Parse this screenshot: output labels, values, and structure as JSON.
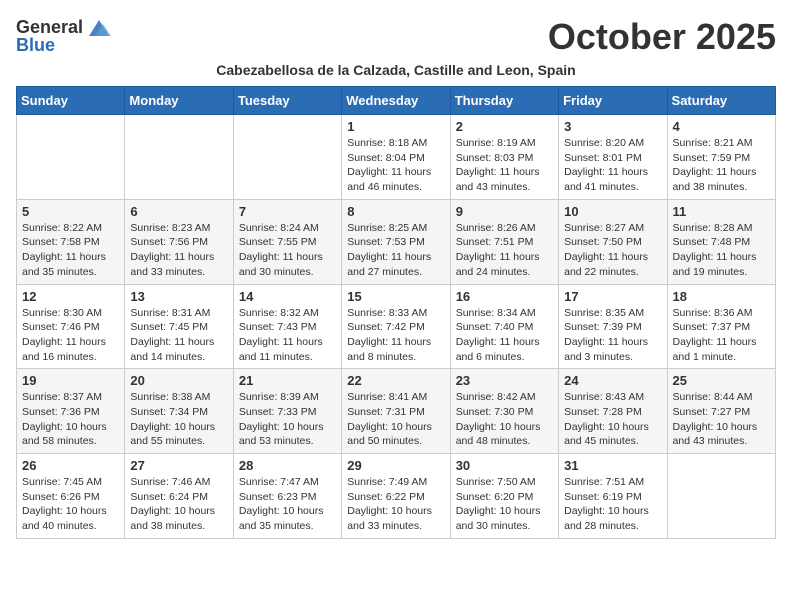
{
  "header": {
    "logo_general": "General",
    "logo_blue": "Blue",
    "month_title": "October 2025",
    "subtitle": "Cabezabellosa de la Calzada, Castille and Leon, Spain"
  },
  "weekdays": [
    "Sunday",
    "Monday",
    "Tuesday",
    "Wednesday",
    "Thursday",
    "Friday",
    "Saturday"
  ],
  "weeks": [
    [
      {
        "day": "",
        "info": ""
      },
      {
        "day": "",
        "info": ""
      },
      {
        "day": "",
        "info": ""
      },
      {
        "day": "1",
        "info": "Sunrise: 8:18 AM\nSunset: 8:04 PM\nDaylight: 11 hours and 46 minutes."
      },
      {
        "day": "2",
        "info": "Sunrise: 8:19 AM\nSunset: 8:03 PM\nDaylight: 11 hours and 43 minutes."
      },
      {
        "day": "3",
        "info": "Sunrise: 8:20 AM\nSunset: 8:01 PM\nDaylight: 11 hours and 41 minutes."
      },
      {
        "day": "4",
        "info": "Sunrise: 8:21 AM\nSunset: 7:59 PM\nDaylight: 11 hours and 38 minutes."
      }
    ],
    [
      {
        "day": "5",
        "info": "Sunrise: 8:22 AM\nSunset: 7:58 PM\nDaylight: 11 hours and 35 minutes."
      },
      {
        "day": "6",
        "info": "Sunrise: 8:23 AM\nSunset: 7:56 PM\nDaylight: 11 hours and 33 minutes."
      },
      {
        "day": "7",
        "info": "Sunrise: 8:24 AM\nSunset: 7:55 PM\nDaylight: 11 hours and 30 minutes."
      },
      {
        "day": "8",
        "info": "Sunrise: 8:25 AM\nSunset: 7:53 PM\nDaylight: 11 hours and 27 minutes."
      },
      {
        "day": "9",
        "info": "Sunrise: 8:26 AM\nSunset: 7:51 PM\nDaylight: 11 hours and 24 minutes."
      },
      {
        "day": "10",
        "info": "Sunrise: 8:27 AM\nSunset: 7:50 PM\nDaylight: 11 hours and 22 minutes."
      },
      {
        "day": "11",
        "info": "Sunrise: 8:28 AM\nSunset: 7:48 PM\nDaylight: 11 hours and 19 minutes."
      }
    ],
    [
      {
        "day": "12",
        "info": "Sunrise: 8:30 AM\nSunset: 7:46 PM\nDaylight: 11 hours and 16 minutes."
      },
      {
        "day": "13",
        "info": "Sunrise: 8:31 AM\nSunset: 7:45 PM\nDaylight: 11 hours and 14 minutes."
      },
      {
        "day": "14",
        "info": "Sunrise: 8:32 AM\nSunset: 7:43 PM\nDaylight: 11 hours and 11 minutes."
      },
      {
        "day": "15",
        "info": "Sunrise: 8:33 AM\nSunset: 7:42 PM\nDaylight: 11 hours and 8 minutes."
      },
      {
        "day": "16",
        "info": "Sunrise: 8:34 AM\nSunset: 7:40 PM\nDaylight: 11 hours and 6 minutes."
      },
      {
        "day": "17",
        "info": "Sunrise: 8:35 AM\nSunset: 7:39 PM\nDaylight: 11 hours and 3 minutes."
      },
      {
        "day": "18",
        "info": "Sunrise: 8:36 AM\nSunset: 7:37 PM\nDaylight: 11 hours and 1 minute."
      }
    ],
    [
      {
        "day": "19",
        "info": "Sunrise: 8:37 AM\nSunset: 7:36 PM\nDaylight: 10 hours and 58 minutes."
      },
      {
        "day": "20",
        "info": "Sunrise: 8:38 AM\nSunset: 7:34 PM\nDaylight: 10 hours and 55 minutes."
      },
      {
        "day": "21",
        "info": "Sunrise: 8:39 AM\nSunset: 7:33 PM\nDaylight: 10 hours and 53 minutes."
      },
      {
        "day": "22",
        "info": "Sunrise: 8:41 AM\nSunset: 7:31 PM\nDaylight: 10 hours and 50 minutes."
      },
      {
        "day": "23",
        "info": "Sunrise: 8:42 AM\nSunset: 7:30 PM\nDaylight: 10 hours and 48 minutes."
      },
      {
        "day": "24",
        "info": "Sunrise: 8:43 AM\nSunset: 7:28 PM\nDaylight: 10 hours and 45 minutes."
      },
      {
        "day": "25",
        "info": "Sunrise: 8:44 AM\nSunset: 7:27 PM\nDaylight: 10 hours and 43 minutes."
      }
    ],
    [
      {
        "day": "26",
        "info": "Sunrise: 7:45 AM\nSunset: 6:26 PM\nDaylight: 10 hours and 40 minutes."
      },
      {
        "day": "27",
        "info": "Sunrise: 7:46 AM\nSunset: 6:24 PM\nDaylight: 10 hours and 38 minutes."
      },
      {
        "day": "28",
        "info": "Sunrise: 7:47 AM\nSunset: 6:23 PM\nDaylight: 10 hours and 35 minutes."
      },
      {
        "day": "29",
        "info": "Sunrise: 7:49 AM\nSunset: 6:22 PM\nDaylight: 10 hours and 33 minutes."
      },
      {
        "day": "30",
        "info": "Sunrise: 7:50 AM\nSunset: 6:20 PM\nDaylight: 10 hours and 30 minutes."
      },
      {
        "day": "31",
        "info": "Sunrise: 7:51 AM\nSunset: 6:19 PM\nDaylight: 10 hours and 28 minutes."
      },
      {
        "day": "",
        "info": ""
      }
    ]
  ]
}
